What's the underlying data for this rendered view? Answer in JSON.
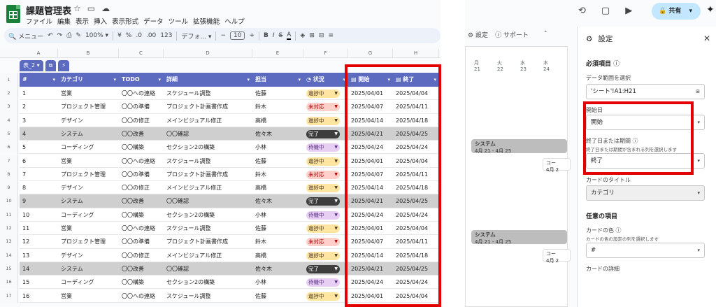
{
  "app": {
    "title": "課題管理表",
    "menu": [
      "ファイル",
      "編集",
      "表示",
      "挿入",
      "表示形式",
      "データ",
      "ツール",
      "拡張機能",
      "ヘルプ"
    ],
    "toolbar": {
      "search": "メニュー",
      "zoom": "100%",
      "currency": "¥",
      "percent": "%",
      "dec_dec": ".0",
      "dec_inc": ".00",
      "format_123": "123",
      "font": "デフォ...",
      "font_size": "10"
    }
  },
  "sheet": {
    "columns": [
      "A",
      "B",
      "C",
      "D",
      "E",
      "F",
      "G",
      "H"
    ],
    "table_name": "表_2",
    "headers": [
      "#",
      "カテゴリ",
      "TODO",
      "詳細",
      "担当",
      "状況",
      "開始",
      "終了"
    ],
    "row_numbers": [
      "1",
      "2",
      "3",
      "4",
      "5",
      "6",
      "7",
      "8",
      "9",
      "10",
      "11",
      "12",
      "13",
      "14",
      "15",
      "16",
      "17"
    ],
    "rows": [
      [
        "1",
        "営業",
        "〇〇への連絡",
        "スケジュール調整",
        "佐藤",
        "進捗中",
        "2025/04/01",
        "2025/04/04"
      ],
      [
        "2",
        "プロジェクト管理",
        "〇〇の準備",
        "プロジェクト計画書作成",
        "鈴木",
        "未対応",
        "2025/04/07",
        "2025/04/11"
      ],
      [
        "3",
        "デザイン",
        "〇〇の修正",
        "メインビジュアル修正",
        "高橋",
        "進捗中",
        "2025/04/14",
        "2025/04/18"
      ],
      [
        "4",
        "システム",
        "〇〇改善",
        "〇〇確認",
        "佐々木",
        "完了",
        "2025/04/21",
        "2025/04/25"
      ],
      [
        "5",
        "コーディング",
        "〇〇構築",
        "セクション2の構築",
        "小林",
        "待機中",
        "2025/04/24",
        "2025/04/24"
      ],
      [
        "6",
        "営業",
        "〇〇への連絡",
        "スケジュール調整",
        "佐藤",
        "進捗中",
        "2025/04/01",
        "2025/04/04"
      ],
      [
        "7",
        "プロジェクト管理",
        "〇〇の準備",
        "プロジェクト計画書作成",
        "鈴木",
        "未対応",
        "2025/04/07",
        "2025/04/11"
      ],
      [
        "8",
        "デザイン",
        "〇〇の修正",
        "メインビジュアル修正",
        "高橋",
        "進捗中",
        "2025/04/14",
        "2025/04/18"
      ],
      [
        "9",
        "システム",
        "〇〇改善",
        "〇〇確認",
        "佐々木",
        "完了",
        "2025/04/21",
        "2025/04/25"
      ],
      [
        "10",
        "コーディング",
        "〇〇構築",
        "セクション2の構築",
        "小林",
        "待機中",
        "2025/04/24",
        "2025/04/24"
      ],
      [
        "11",
        "営業",
        "〇〇への連絡",
        "スケジュール調整",
        "佐藤",
        "進捗中",
        "2025/04/01",
        "2025/04/04"
      ],
      [
        "12",
        "プロジェクト管理",
        "〇〇の準備",
        "プロジェクト計画書作成",
        "鈴木",
        "未対応",
        "2025/04/07",
        "2025/04/11"
      ],
      [
        "13",
        "デザイン",
        "〇〇の修正",
        "メインビジュアル修正",
        "高橋",
        "進捗中",
        "2025/04/14",
        "2025/04/18"
      ],
      [
        "14",
        "システム",
        "〇〇改善",
        "〇〇確認",
        "佐々木",
        "完了",
        "2025/04/21",
        "2025/04/25"
      ],
      [
        "15",
        "コーディング",
        "〇〇構築",
        "セクション2の構築",
        "小林",
        "待機中",
        "2025/04/24",
        "2025/04/24"
      ],
      [
        "16",
        "営業",
        "〇〇への連絡",
        "スケジュール調整",
        "佐藤",
        "進捗中",
        "2025/04/01",
        "2025/04/04"
      ]
    ],
    "status_colors": {
      "進捗中": {
        "bg": "#ffe5a0",
        "fg": "#473821"
      },
      "未対応": {
        "bg": "#ffcfc9",
        "fg": "#b10202"
      },
      "完了": {
        "bg": "#3d3d3d",
        "fg": "#ffffff"
      },
      "待機中": {
        "bg": "#e6cff2",
        "fg": "#5a3286"
      }
    },
    "header_color": "#5c6bc0",
    "highlight_color": "#e50000"
  },
  "timeline": {
    "settings_label": "設定",
    "support_label": "サポート",
    "days": [
      {
        "dow": "月",
        "day": "21"
      },
      {
        "dow": "火",
        "day": "22"
      },
      {
        "dow": "水",
        "day": "23"
      },
      {
        "dow": "木",
        "day": "24"
      }
    ],
    "cards": [
      {
        "title": "システム",
        "dates": "4月 21 - 4月 25"
      },
      {
        "title": "システム",
        "dates": "4月 21 - 4月 25"
      }
    ],
    "side_cards": [
      {
        "title": "コー",
        "dates": "4月 2"
      },
      {
        "title": "コー",
        "dates": "4月 2"
      }
    ]
  },
  "topbar": {
    "share_label": "共有"
  },
  "settings": {
    "title": "設定",
    "required_label": "必須項目",
    "range_label": "データ範囲を選択",
    "range_value": "'シート'!A1:H21",
    "start_label": "開始日",
    "start_value": "開始",
    "end_label": "終了日または期間",
    "end_sub": "終了日または期間が含まれる列を選択します",
    "end_value": "終了",
    "card_title_label": "カードのタイトル",
    "card_title_value": "カテゴリ",
    "optional_label": "任意の項目",
    "card_color_label": "カードの色",
    "card_color_sub": "カードの色の設定の列を選択します",
    "card_color_value": "#",
    "card_detail_label": "カードの詳細"
  }
}
